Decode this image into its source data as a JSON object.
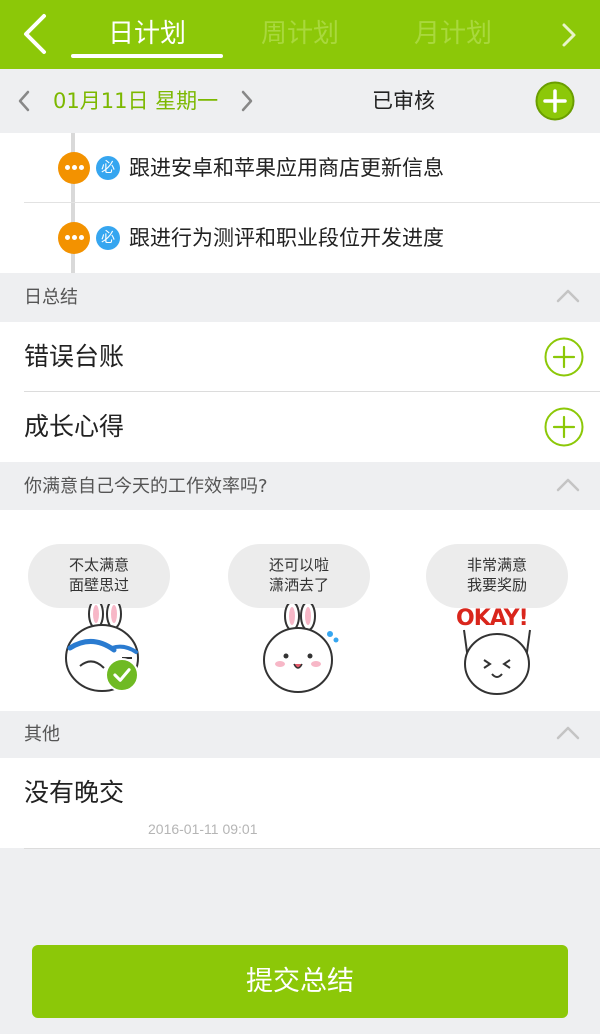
{
  "colors": {
    "brand": "#8cc808",
    "date_green": "#7cb800",
    "orange": "#f39200",
    "blue": "#36a6f0",
    "check_green": "#6fba23"
  },
  "header": {
    "back_icon": "chevron-left-icon",
    "tabs": [
      {
        "label": "日计划",
        "active": true
      },
      {
        "label": "周计划",
        "active": false
      },
      {
        "label": "月计划",
        "active": false
      }
    ],
    "more_icon": "chevron-right-icon"
  },
  "datebar": {
    "date": "01月11日 星期一",
    "status": "已审核",
    "prev_icon": "chevron-left-icon",
    "next_icon": "chevron-right-icon",
    "add_icon": "plus-circle-icon"
  },
  "tasks": [
    {
      "badge": "必",
      "text": "跟进安卓和苹果应用商店更新信息"
    },
    {
      "badge": "必",
      "text": "跟进行为测评和职业段位开发进度"
    }
  ],
  "sections": {
    "daily_summary": {
      "title": "日总结",
      "rows": [
        {
          "label": "错误台账"
        },
        {
          "label": "成长心得"
        }
      ]
    },
    "satisfaction": {
      "title": "你满意自己今天的工作效率吗?",
      "options": [
        {
          "line1": "不太满意",
          "line2": "面壁思过",
          "selected": true
        },
        {
          "line1": "还可以啦",
          "line2": "潇洒去了",
          "selected": false
        },
        {
          "line1": "非常满意",
          "line2": "我要奖励",
          "sign": "OKAY!",
          "selected": false
        }
      ]
    },
    "others": {
      "title": "其他",
      "text": "没有晚交",
      "time": "2016-01-11 09:01"
    }
  },
  "submit_label": "提交总结"
}
